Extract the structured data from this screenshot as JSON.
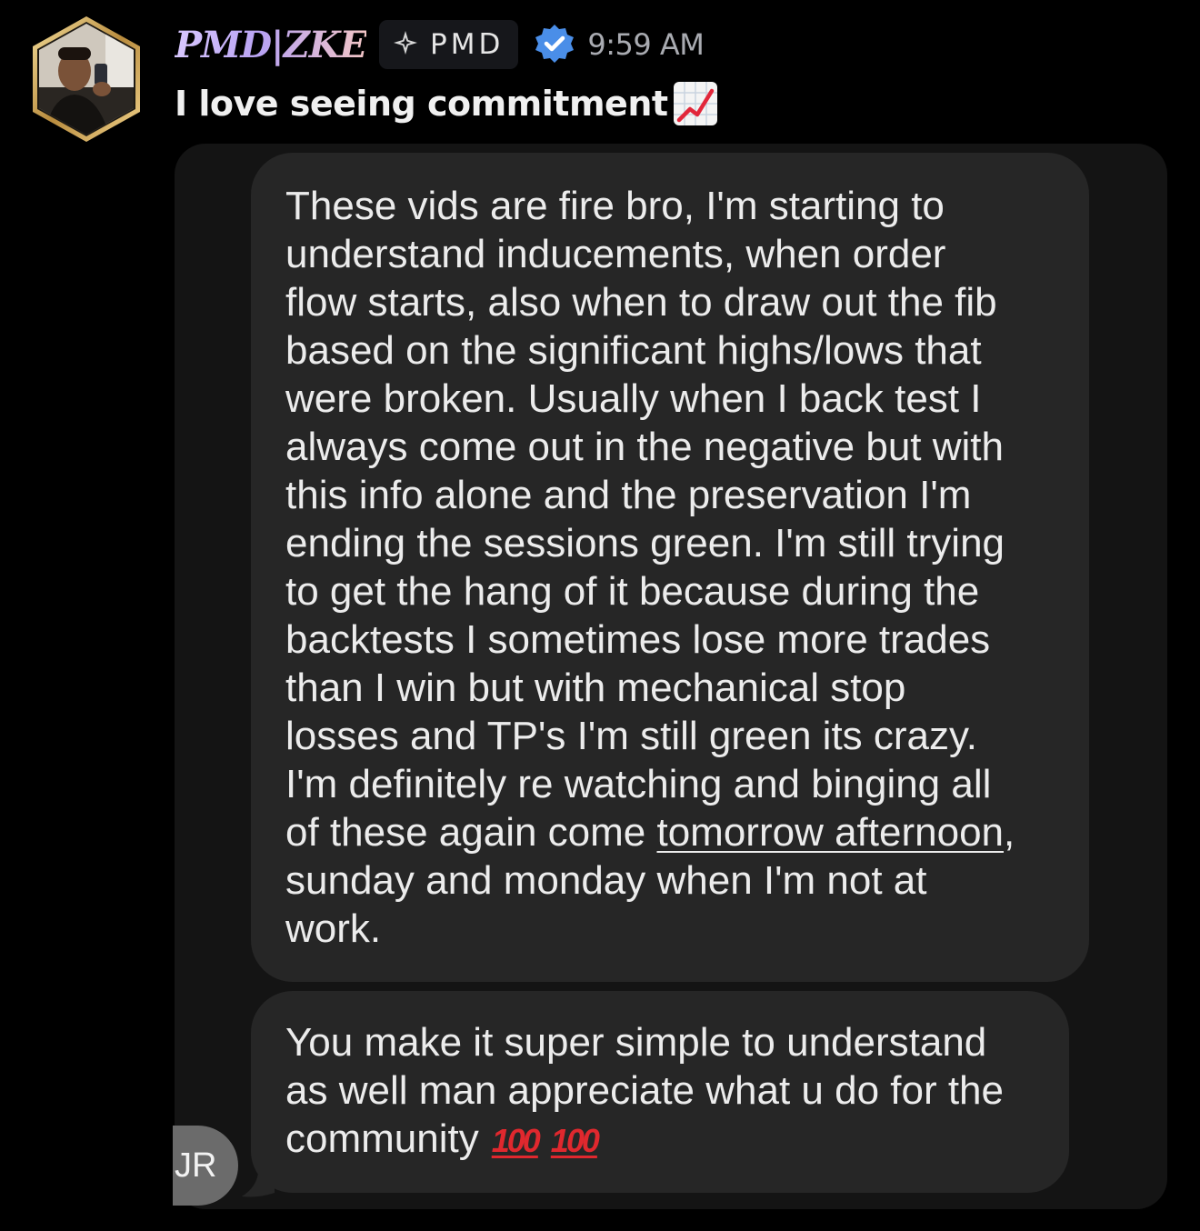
{
  "message": {
    "author": "PMD|ZKE",
    "role_tag": "PMD",
    "timestamp": "9:59 AM",
    "text": "I love seeing commitment",
    "colors": {
      "background": "#000000",
      "role_tag_bg": "#16171b",
      "verified_badge": "#4a8ee8",
      "timestamp": "#a9abb1"
    },
    "icons": {
      "avatar": "avatar-photo-hexagon",
      "role": "diamond-sparkle-icon",
      "verified": "verified-badge-icon",
      "emoji": "chart-increasing-emoji"
    }
  },
  "attachment": {
    "bubble_1": {
      "lines": [
        "These vids are fire bro, I'm starting to",
        "understand inducements, when order",
        "flow starts, also when to draw out the fib",
        "based on the significant highs/lows that",
        "were broken. Usually when I back test I",
        "always come out in the negative but with",
        "this info alone and the preservation I'm",
        "ending the sessions green. I'm still trying",
        "to get the hang of it because during the",
        "backtests I sometimes lose more trades",
        "than I win but with mechanical stop",
        "losses and TP's I'm still green its crazy.",
        "I'm definitely re watching and binging all"
      ],
      "line_14_before": "of these again come ",
      "line_14_link": "tomorrow afternoon",
      "line_14_after": ",",
      "lines_end": [
        "sunday and monday when I'm not at",
        "work."
      ]
    },
    "bubble_2": {
      "lines": [
        "You make it super simple to understand",
        "as well man appreciate what u do for the"
      ],
      "last_line_text": "community",
      "emoji_1": "100",
      "emoji_2": "100"
    },
    "sender_initials": "JR",
    "colors": {
      "card_bg": "#141414",
      "bubble_bg": "#262626",
      "bubble_text": "#ececec",
      "initials_bg": "#6b6b6b",
      "hundred_emoji": "#e0282e"
    }
  }
}
